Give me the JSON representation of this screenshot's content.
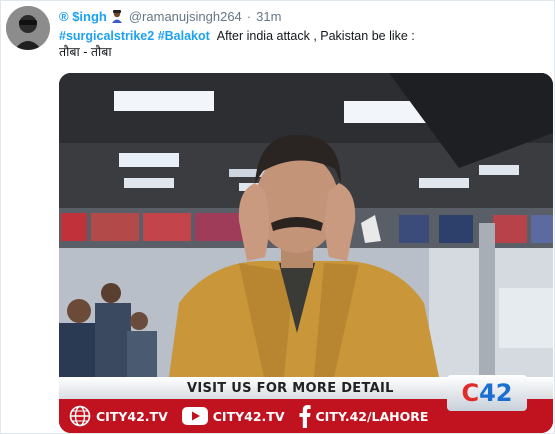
{
  "tweet": {
    "display_name": "® $ingh",
    "handle": "@ramanujsingh264",
    "separator": "·",
    "time": "31m",
    "hashtags": [
      "#surgicalstrike2",
      "#Balakot"
    ],
    "text_line1": "After india attack , Pakistan be like :",
    "text_line2": "तौबा - तौबा"
  },
  "video": {
    "ticker_top": "VISIT US FOR MORE DETAIL",
    "website": "CITY42.TV",
    "youtube": "CITY42.TV",
    "facebook": "CITY.42/LAHORE",
    "logo_c": "C",
    "logo_num": "42"
  },
  "colors": {
    "link_blue": "#1da1f2",
    "ticker_red": "#c1121f",
    "jacket": "#c9963a"
  },
  "icons": [
    "globe-icon",
    "youtube-icon",
    "facebook-icon",
    "verified-emoji-icon"
  ]
}
